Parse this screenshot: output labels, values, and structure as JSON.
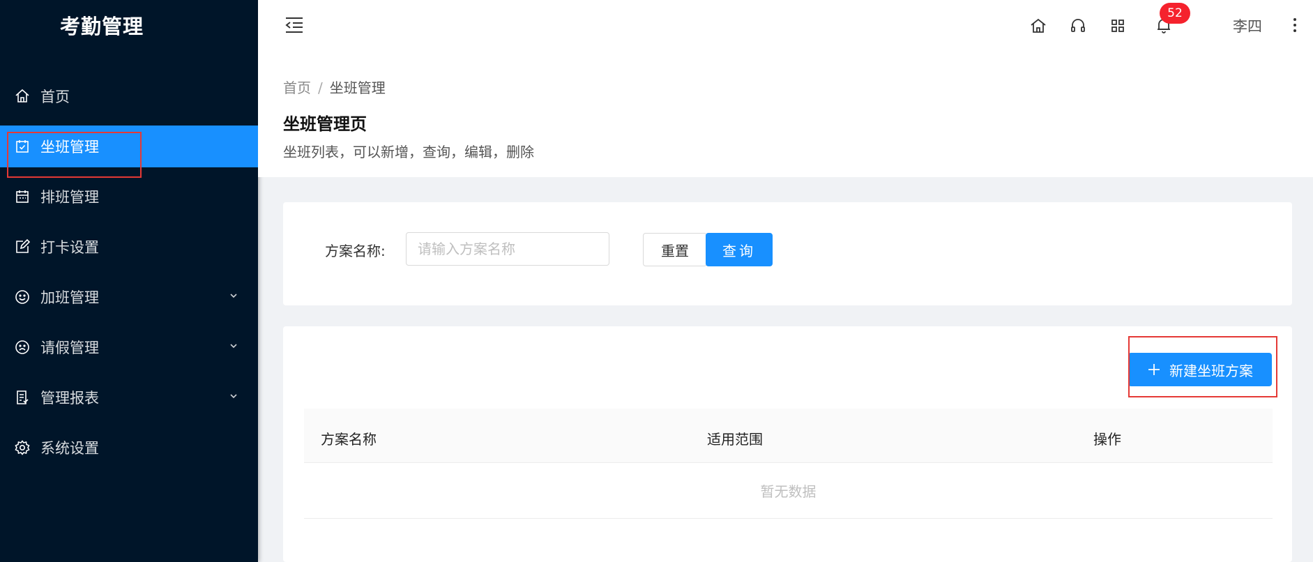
{
  "app": {
    "title": "考勤管理"
  },
  "sidebar": {
    "items": [
      {
        "label": "首页",
        "icon": "home-icon"
      },
      {
        "label": "坐班管理",
        "icon": "calendar-check-icon",
        "active": true
      },
      {
        "label": "排班管理",
        "icon": "calendar-icon"
      },
      {
        "label": "打卡设置",
        "icon": "edit-icon"
      },
      {
        "label": "加班管理",
        "icon": "smile-icon",
        "expandable": true
      },
      {
        "label": "请假管理",
        "icon": "frown-icon",
        "expandable": true
      },
      {
        "label": "管理报表",
        "icon": "report-icon",
        "expandable": true
      },
      {
        "label": "系统设置",
        "icon": "gear-icon"
      }
    ]
  },
  "header": {
    "notification_count": "52",
    "username": "李四"
  },
  "breadcrumb": {
    "home": "首页",
    "separator": "/",
    "current": "坐班管理"
  },
  "page": {
    "title": "坐班管理页",
    "description": "坐班列表，可以新增，查询，编辑，删除"
  },
  "search": {
    "label": "方案名称:",
    "placeholder": "请输入方案名称",
    "value": "",
    "reset_label": "重置",
    "query_label": "查询"
  },
  "table": {
    "new_button_label": "新建坐班方案",
    "columns": [
      "方案名称",
      "适用范围",
      "操作"
    ],
    "rows": [],
    "empty_text": "暂无数据"
  },
  "colors": {
    "sidebar_bg": "#001529",
    "primary": "#1890ff",
    "badge": "#f5222d",
    "highlight_outline": "#e53935"
  }
}
